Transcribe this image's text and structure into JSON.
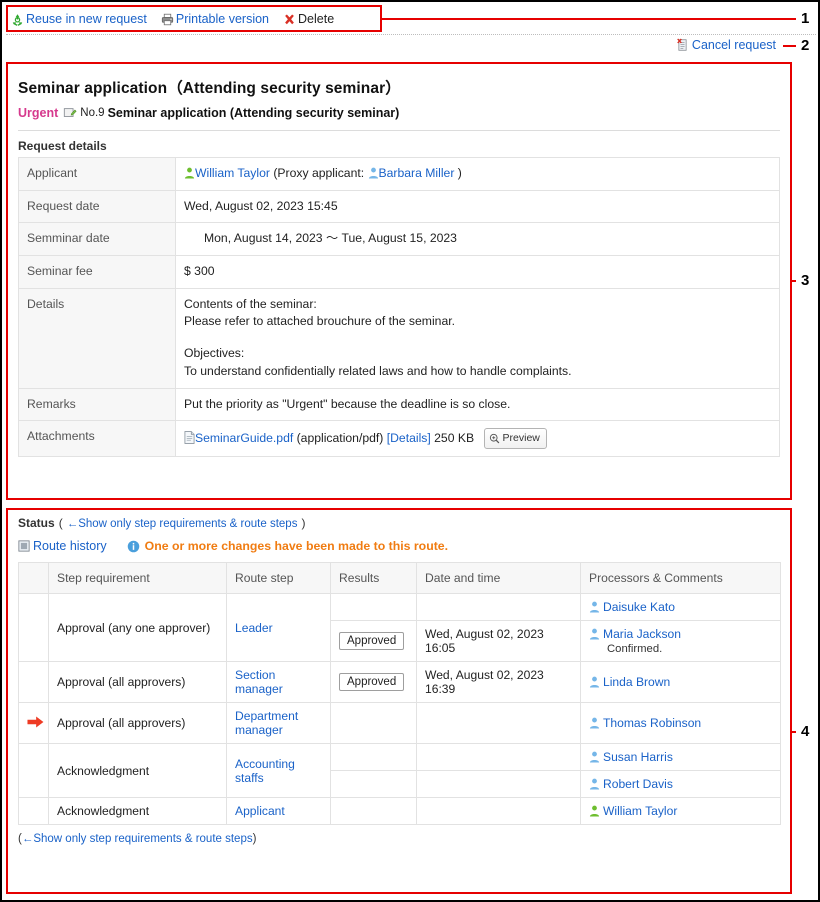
{
  "toolbar": {
    "items": [
      {
        "icon": "recycle-icon",
        "label": "Reuse in new request",
        "style": "link"
      },
      {
        "icon": "printer-icon",
        "label": "Printable version",
        "style": "link"
      },
      {
        "icon": "red-x-icon",
        "label": "Delete",
        "style": "plain"
      }
    ]
  },
  "cancel": {
    "icon": "cancel-request-icon",
    "label": "Cancel request"
  },
  "request": {
    "title": "Seminar application（Attending security seminar）",
    "priority": "Urgent",
    "number": "No.9",
    "subtitle": "Seminar application (Attending security seminar)",
    "section_label": "Request details",
    "rows": [
      {
        "label": "Applicant",
        "type": "applicant",
        "applicant_name": "William Taylor",
        "proxy_prefix": "(Proxy applicant:",
        "proxy_name": "Barbara Miller",
        "proxy_suffix": ")"
      },
      {
        "label": "Request date",
        "type": "text",
        "value": "Wed, August 02, 2023 15:45"
      },
      {
        "label": "Semminar date",
        "type": "text",
        "value": "Mon, August 14, 2023 〜 Tue, August 15, 2023",
        "indent": true
      },
      {
        "label": "Seminar fee",
        "type": "text",
        "value": "$ 300"
      },
      {
        "label": "Details",
        "type": "multiline",
        "lines": [
          "Contents of the seminar:",
          "Please refer to attached brouchure of the seminar.",
          "",
          "Objectives:",
          "To understand confidentially related laws and how to handle complaints."
        ]
      },
      {
        "label": "Remarks",
        "type": "text",
        "value": "Put the priority as \"Urgent\" because the deadline is so close."
      },
      {
        "label": "Attachments",
        "type": "attachment",
        "file_icon": "document-icon",
        "file_name": "SeminarGuide.pdf",
        "mime": "(application/pdf)",
        "details_link": "[Details]",
        "size": "250 KB",
        "preview_icon": "magnifier-plus-icon",
        "preview_label": "Preview"
      }
    ]
  },
  "status": {
    "title": "Status",
    "toggle_open_paren": "(",
    "toggle_label": "←Show only step requirements & route steps",
    "toggle_close_paren": ")",
    "route_history": {
      "icon": "route-history-icon",
      "label": "Route history"
    },
    "route_note": {
      "icon": "info-icon",
      "label": "One or more changes have been made to this route."
    },
    "columns": [
      "",
      "Step requirement",
      "Route step",
      "Results",
      "Date and time",
      "Processors & Comments"
    ],
    "rows": [
      {
        "current": false,
        "arrow": "",
        "step_requirement": "Approval (any one approver)",
        "route_step": "Leader",
        "processors": [
          {
            "name": "Daisuke Kato",
            "icon": "user-icon-blue",
            "result": "",
            "datetime": "",
            "comment": ""
          },
          {
            "name": "Maria Jackson",
            "icon": "user-icon-blue",
            "result": "Approved",
            "datetime": "Wed, August 02, 2023 16:05",
            "comment": "Confirmed."
          }
        ]
      },
      {
        "current": false,
        "arrow": "",
        "step_requirement": "Approval (all approvers)",
        "route_step": "Section manager",
        "processors": [
          {
            "name": "Linda Brown",
            "icon": "user-icon-blue",
            "result": "Approved",
            "datetime": "Wed, August 02, 2023 16:39",
            "comment": ""
          }
        ]
      },
      {
        "current": true,
        "arrow": "right-arrow-icon",
        "step_requirement": "Approval (all approvers)",
        "route_step": "Department manager",
        "processors": [
          {
            "name": "Thomas Robinson",
            "icon": "user-icon-blue",
            "result": "",
            "datetime": "",
            "comment": ""
          }
        ]
      },
      {
        "current": false,
        "arrow": "",
        "step_requirement": "Acknowledgment",
        "route_step": "Accounting staffs",
        "processors": [
          {
            "name": "Susan Harris",
            "icon": "user-icon-blue",
            "result": "",
            "datetime": "",
            "comment": ""
          },
          {
            "name": "Robert Davis",
            "icon": "user-icon-blue",
            "result": "",
            "datetime": "",
            "comment": ""
          }
        ]
      },
      {
        "current": false,
        "arrow": "",
        "step_requirement": "Acknowledgment",
        "route_step": "Applicant",
        "processors": [
          {
            "name": "William Taylor",
            "icon": "user-icon-green",
            "result": "",
            "datetime": "",
            "comment": ""
          }
        ]
      }
    ],
    "bottom_toggle": {
      "open_paren": "(",
      "label": "←Show only step requirements & route steps",
      "close_paren": ")"
    }
  },
  "annotations": [
    {
      "number": "1"
    },
    {
      "number": "2"
    },
    {
      "number": "3"
    },
    {
      "number": "4"
    }
  ],
  "colors": {
    "link": "#1a62c8",
    "urgent": "#d6398d",
    "note": "#f07c12",
    "annotation": "#e60000",
    "current_row": "#faf3cf"
  }
}
